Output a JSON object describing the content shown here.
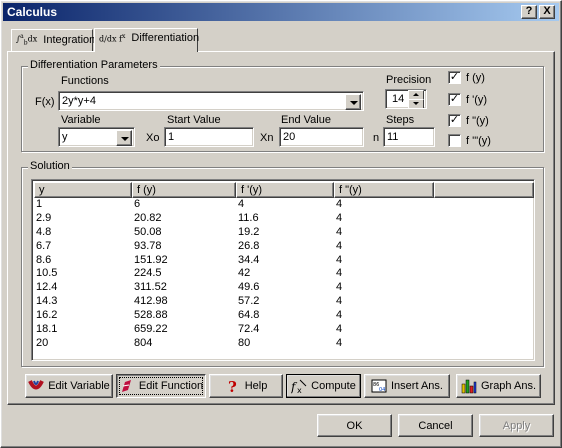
{
  "window": {
    "title": "Calculus",
    "help_label": "?",
    "close_label": "X"
  },
  "tabs": [
    {
      "label": "Integration",
      "active": false
    },
    {
      "label": "Differentiation",
      "active": true
    }
  ],
  "diff_params": {
    "legend": "Differentiation Parameters",
    "functions_label": "Functions",
    "fx_label": "F(x)",
    "function_value": "2y*y+4",
    "precision_label": "Precision",
    "precision_value": "14",
    "variable_label": "Variable",
    "variable_value": "y",
    "start_value_label": "Start Value",
    "xo_label": "Xo",
    "start_value": "1",
    "end_value_label": "End Value",
    "xn_label": "Xn",
    "end_value": "20",
    "steps_label": "Steps",
    "n_label": "n",
    "steps_value": "11",
    "derivative_options": [
      {
        "label": "f (y)",
        "checked": true
      },
      {
        "label": "f '(y)",
        "checked": true
      },
      {
        "label": "f \"(y)",
        "checked": true
      },
      {
        "label": "f '\"(y)",
        "checked": false
      }
    ]
  },
  "solution": {
    "legend": "Solution",
    "columns": [
      "y",
      "f (y)",
      "f '(y)",
      "f \"(y)"
    ],
    "rows": [
      [
        "1",
        "6",
        "4",
        "4"
      ],
      [
        "2.9",
        "20.82",
        "11.6",
        "4"
      ],
      [
        "4.8",
        "50.08",
        "19.2",
        "4"
      ],
      [
        "6.7",
        "93.78",
        "26.8",
        "4"
      ],
      [
        "8.6",
        "151.92",
        "34.4",
        "4"
      ],
      [
        "10.5",
        "224.5",
        "42",
        "4"
      ],
      [
        "12.4",
        "311.52",
        "49.6",
        "4"
      ],
      [
        "14.3",
        "412.98",
        "57.2",
        "4"
      ],
      [
        "16.2",
        "528.88",
        "64.8",
        "4"
      ],
      [
        "18.1",
        "659.22",
        "72.4",
        "4"
      ],
      [
        "20",
        "804",
        "80",
        "4"
      ]
    ]
  },
  "toolbar": {
    "edit_variable": "Edit Variable",
    "edit_function": "Edit Function",
    "help": "Help",
    "compute": "Compute",
    "insert_ans": "Insert Ans.",
    "graph_ans": "Graph Ans."
  },
  "dialog_buttons": {
    "ok": "OK",
    "cancel": "Cancel",
    "apply": "Apply"
  },
  "colors": {
    "title_start": "#0a246a",
    "title_end": "#a6caf0",
    "face": "#d4d0c8"
  }
}
